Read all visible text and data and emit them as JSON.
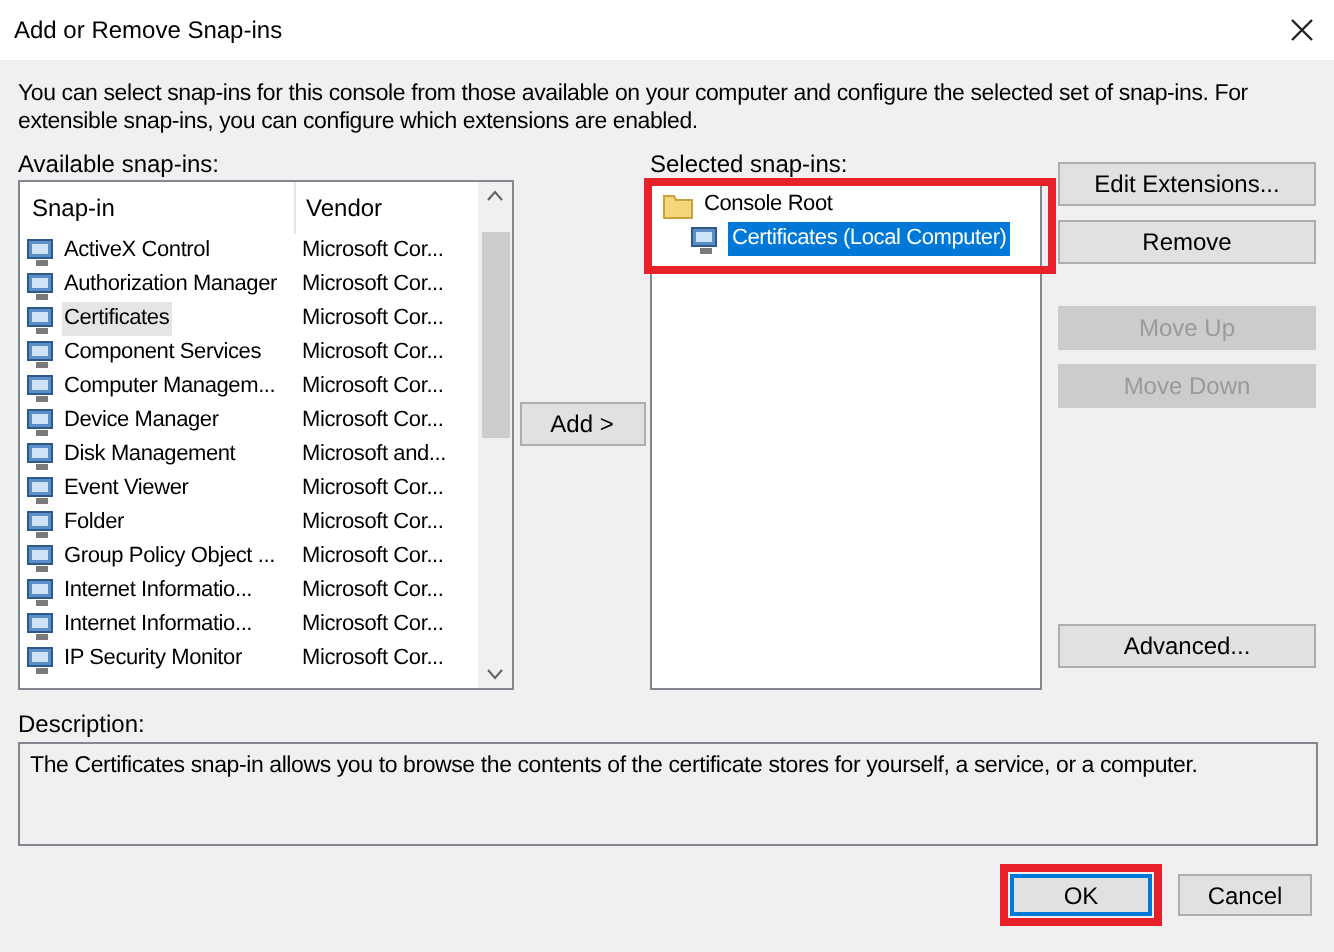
{
  "window": {
    "title": "Add or Remove Snap-ins"
  },
  "intro": "You can select snap-ins for this console from those available on your computer and configure the selected set of snap-ins. For extensible snap-ins, you can configure which extensions are enabled.",
  "available": {
    "label": "Available snap-ins:",
    "columns": [
      "Snap-in",
      "Vendor"
    ],
    "rows": [
      {
        "name": "ActiveX Control",
        "vendor": "Microsoft Cor...",
        "selected": false
      },
      {
        "name": "Authorization Manager",
        "vendor": "Microsoft Cor...",
        "selected": false
      },
      {
        "name": "Certificates",
        "vendor": "Microsoft Cor...",
        "selected": true
      },
      {
        "name": "Component Services",
        "vendor": "Microsoft Cor...",
        "selected": false
      },
      {
        "name": "Computer Managem...",
        "vendor": "Microsoft Cor...",
        "selected": false
      },
      {
        "name": "Device Manager",
        "vendor": "Microsoft Cor...",
        "selected": false
      },
      {
        "name": "Disk Management",
        "vendor": "Microsoft and...",
        "selected": false
      },
      {
        "name": "Event Viewer",
        "vendor": "Microsoft Cor...",
        "selected": false
      },
      {
        "name": "Folder",
        "vendor": "Microsoft Cor...",
        "selected": false
      },
      {
        "name": "Group Policy Object ...",
        "vendor": "Microsoft Cor...",
        "selected": false
      },
      {
        "name": "Internet Informatio...",
        "vendor": "Microsoft Cor...",
        "selected": false
      },
      {
        "name": "Internet Informatio...",
        "vendor": "Microsoft Cor...",
        "selected": false
      },
      {
        "name": "IP Security Monitor",
        "vendor": "Microsoft Cor...",
        "selected": false
      }
    ]
  },
  "add_button": "Add >",
  "selected_snapins": {
    "label": "Selected snap-ins:",
    "tree": [
      {
        "label": "Console Root",
        "selected": false,
        "children": [
          {
            "label": "Certificates (Local Computer)",
            "selected": true
          }
        ]
      }
    ]
  },
  "side_buttons": [
    {
      "label": "Edit Extensions...",
      "disabled": false
    },
    {
      "label": "Remove",
      "disabled": false
    },
    {
      "label": "Move Up",
      "disabled": true
    },
    {
      "label": "Move Down",
      "disabled": true
    },
    {
      "label": "Advanced...",
      "disabled": false
    }
  ],
  "description": {
    "label": "Description:",
    "text": "The Certificates snap-in allows you to browse the contents of the certificate stores for yourself, a service, or a computer."
  },
  "footer_buttons": [
    {
      "label": "OK",
      "default": true
    },
    {
      "label": "Cancel",
      "default": false
    }
  ]
}
